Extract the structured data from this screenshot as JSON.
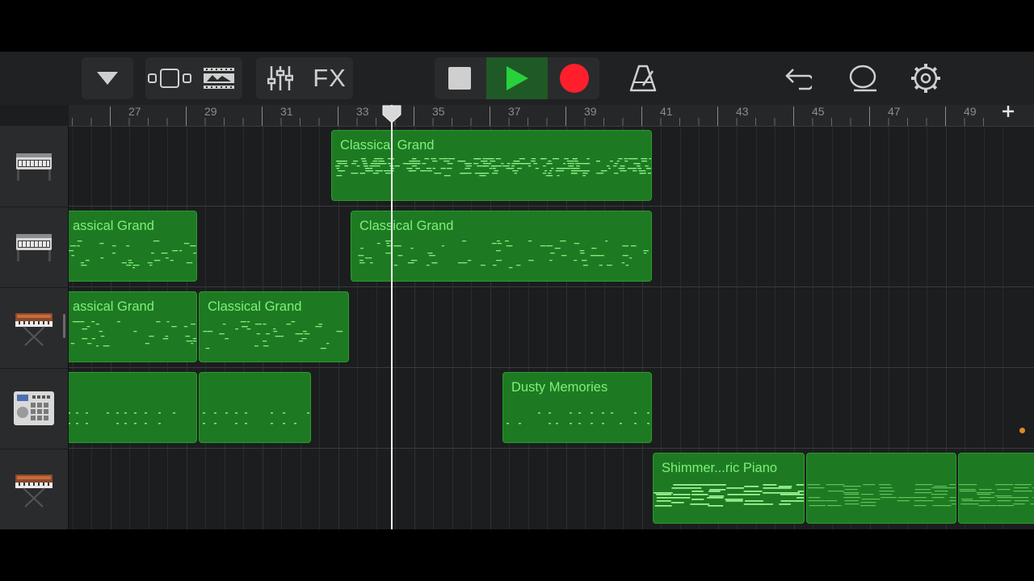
{
  "toolbar": {
    "buttons": [
      {
        "name": "browser-toggle-button",
        "icon": "triangle-down-icon"
      },
      {
        "name": "tracks-view-button",
        "icon": "tracks-view-icon"
      },
      {
        "name": "loop-browser-button",
        "icon": "loop-icon"
      },
      {
        "name": "mixer-button",
        "icon": "sliders-icon"
      },
      {
        "name": "fx-button",
        "label": "FX"
      },
      {
        "name": "stop-button",
        "icon": "stop-icon"
      },
      {
        "name": "play-button",
        "icon": "play-icon"
      },
      {
        "name": "record-button",
        "icon": "record-icon"
      },
      {
        "name": "metronome-button",
        "icon": "metronome-icon"
      },
      {
        "name": "undo-button",
        "icon": "undo-icon"
      },
      {
        "name": "loop-settings-button",
        "icon": "lasso-icon"
      },
      {
        "name": "settings-button",
        "icon": "gear-icon"
      }
    ],
    "fx_label": "FX"
  },
  "ruler": {
    "bars": [
      "27",
      "29",
      "31",
      "33",
      "35",
      "37",
      "39",
      "41",
      "43",
      "45",
      "47",
      "49"
    ],
    "add_label": "+"
  },
  "tracks": [
    {
      "instrument_icon": "grand-piano-icon",
      "regions": [
        {
          "title": "Classical Grand"
        }
      ]
    },
    {
      "instrument_icon": "grand-piano-icon",
      "regions": [
        {
          "title": "assical Grand"
        },
        {
          "title": "Classical Grand"
        }
      ]
    },
    {
      "instrument_icon": "synth-keyboard-icon",
      "regions": [
        {
          "title": "assical Grand"
        },
        {
          "title": "Classical Grand"
        }
      ]
    },
    {
      "instrument_icon": "drum-machine-icon",
      "regions": [
        {
          "title": ""
        },
        {
          "title": ""
        },
        {
          "title": "Dusty Memories"
        }
      ]
    },
    {
      "instrument_icon": "synth-keyboard-icon",
      "regions": [
        {
          "title": "Shimmer...ric Piano"
        },
        {
          "title": ""
        },
        {
          "title": ""
        }
      ]
    }
  ],
  "colors": {
    "region_fill": "#1e7a22",
    "region_text": "#7ef07a",
    "play": "#28d23c",
    "record": "#ff1f2c",
    "background": "#1c1d1f"
  }
}
